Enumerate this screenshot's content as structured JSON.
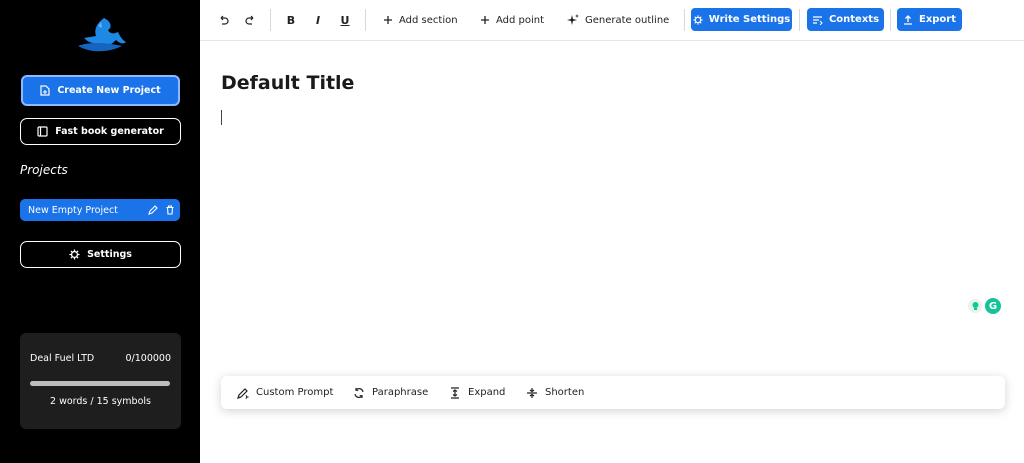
{
  "sidebar": {
    "logo_icon": "wizard-hat-logo",
    "create_button": "Create New Project",
    "fast_book_button": "Fast book generator",
    "projects_heading": "Projects",
    "projects": [
      {
        "label": "New Empty Project"
      }
    ],
    "settings_button": "Settings",
    "stats": {
      "org": "Deal Fuel LTD",
      "count": "0/100000",
      "usage_fraction": 0,
      "words": "2 words / 15 symbols"
    }
  },
  "toolbar": {
    "undo_icon": "undo-icon",
    "redo_icon": "redo-icon",
    "bold": "B",
    "italic": "I",
    "underline": "U",
    "add_section": "Add section",
    "add_point": "Add point",
    "generate_outline": "Generate outline",
    "write_settings": "Write Settings",
    "contexts": "Contexts",
    "export": "Export"
  },
  "editor": {
    "title": "Default Title"
  },
  "actions": {
    "custom_prompt": "Custom Prompt",
    "paraphrase": "Paraphrase",
    "expand": "Expand",
    "shorten": "Shorten"
  },
  "grammarly": {
    "letter": "G"
  },
  "colors": {
    "accent": "#1a73e8",
    "sidebar_bg": "#000000",
    "stats_bg": "#1e1e1e"
  }
}
